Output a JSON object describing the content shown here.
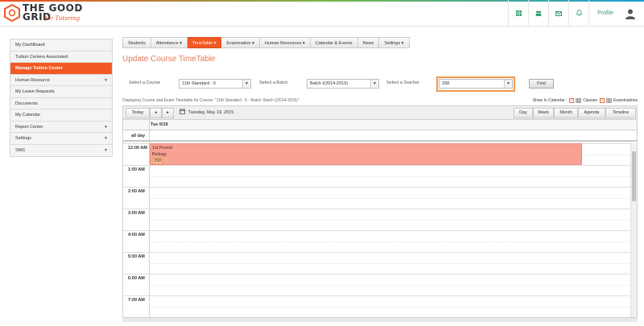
{
  "brand": {
    "name_line1": "THE GOOD",
    "name_line2": "GRID",
    "tagline": "for Tutoring",
    "colors": {
      "accent": "#f15a24",
      "topbar_icon": "#2e9f6a",
      "title": "#e57a54"
    }
  },
  "topbar": {
    "icons": [
      "grid-icon",
      "users-icon",
      "mail-icon",
      "bell-icon"
    ],
    "profile_label": "Profile"
  },
  "sidebar": {
    "items": [
      {
        "label": "My DashBoard",
        "has_caret": false,
        "active": false
      },
      {
        "label": "Tuition Centers Associated",
        "has_caret": false,
        "active": false
      },
      {
        "label": "Manage Tuition Center",
        "has_caret": false,
        "active": true
      },
      {
        "label": "Human Resource",
        "has_caret": true,
        "active": false
      },
      {
        "label": "My Leave Requests",
        "has_caret": false,
        "active": false
      },
      {
        "label": "Documents",
        "has_caret": false,
        "active": false
      },
      {
        "label": "My Calendar",
        "has_caret": false,
        "active": false
      },
      {
        "label": "Report Center",
        "has_caret": true,
        "active": false
      },
      {
        "label": "Settings",
        "has_caret": true,
        "active": false
      },
      {
        "label": "SMS",
        "has_caret": true,
        "active": false
      }
    ]
  },
  "tabs": [
    {
      "label": "Students",
      "caret": "",
      "active": false
    },
    {
      "label": "Attendance",
      "caret": "▾",
      "active": false
    },
    {
      "label": "TimeTable",
      "caret": "▾",
      "active": true
    },
    {
      "label": "Examination",
      "caret": "▾",
      "active": false
    },
    {
      "label": "Human Resources",
      "caret": "▾",
      "active": false
    },
    {
      "label": "Calendar & Events",
      "caret": "",
      "active": false
    },
    {
      "label": "News",
      "caret": "",
      "active": false
    },
    {
      "label": "Settings",
      "caret": "▾",
      "active": false
    }
  ],
  "page": {
    "title": "Update Course TimeTable"
  },
  "filters": {
    "course_label": "Select a Course",
    "course_value": "11th Standard - 5",
    "batch_label": "Select a Batch",
    "batch_value": "Batch I(2014-2015)",
    "teacher_label": "Select a Teacher",
    "teacher_value": "298",
    "find_label": "Find"
  },
  "display_line": "Displaying Course and Exam Timetable for Course: \"11th Standard - 5 - Batch: Batch I(2014-2015)\"",
  "show_calendar": {
    "label": "Show In Calendar :",
    "classes": "Classes",
    "examinations": "Examinations"
  },
  "calendar": {
    "today_label": "Today",
    "prev_label": "◂",
    "next_label": "▸",
    "current_date": "Tuesday, May 19, 2015",
    "views": [
      "Day",
      "Week",
      "Month",
      "Agenda",
      "Timeline"
    ],
    "day_header": "Tue 5/19",
    "allday_label": "all day",
    "times": [
      "12:00 AM",
      "1:00 AM",
      "2:00 AM",
      "3:00 AM",
      "4:00 AM",
      "5:00 AM",
      "6:00 AM",
      "7:00 AM"
    ],
    "event": {
      "line1": "1st Period",
      "line2": "Biology",
      "teacher": "298"
    }
  }
}
